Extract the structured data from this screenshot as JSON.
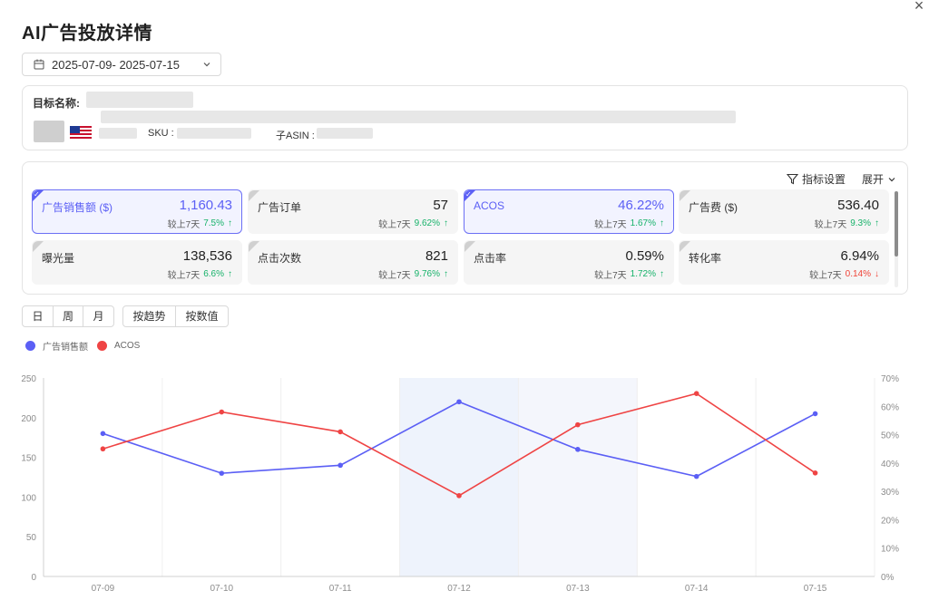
{
  "dialog": {
    "title": "AI广告投放详情",
    "close_symbol": "×"
  },
  "date_range": "2025-07-09- 2025-07-15",
  "target": {
    "name_label": "目标名称:",
    "sku_label": "SKU :",
    "asin_label": "子ASIN :"
  },
  "metrics_toolbar": {
    "settings_label": "指标设置",
    "expand_label": "展开"
  },
  "metrics": [
    {
      "label": "广告销售额 ($)",
      "value": "1,160.43",
      "compare_label": "较上7天",
      "change": "7.5%",
      "direction": "up",
      "arrow": "↑",
      "selected": true
    },
    {
      "label": "广告订单",
      "value": "57",
      "compare_label": "较上7天",
      "change": "9.62%",
      "direction": "up",
      "arrow": "↑",
      "selected": false
    },
    {
      "label": "ACOS",
      "value": "46.22%",
      "compare_label": "较上7天",
      "change": "1.67%",
      "direction": "up",
      "arrow": "↑",
      "selected": true
    },
    {
      "label": "广告费 ($)",
      "value": "536.40",
      "compare_label": "较上7天",
      "change": "9.3%",
      "direction": "up",
      "arrow": "↑",
      "selected": false
    },
    {
      "label": "曝光量",
      "value": "138,536",
      "compare_label": "较上7天",
      "change": "6.6%",
      "direction": "up",
      "arrow": "↑",
      "selected": false
    },
    {
      "label": "点击次数",
      "value": "821",
      "compare_label": "较上7天",
      "change": "9.76%",
      "direction": "up",
      "arrow": "↑",
      "selected": false
    },
    {
      "label": "点击率",
      "value": "0.59%",
      "compare_label": "较上7天",
      "change": "1.72%",
      "direction": "up",
      "arrow": "↑",
      "selected": false
    },
    {
      "label": "转化率",
      "value": "6.94%",
      "compare_label": "较上7天",
      "change": "0.14%",
      "direction": "down",
      "arrow": "↓",
      "selected": false
    }
  ],
  "granularity": {
    "options": [
      "日",
      "周",
      "月"
    ],
    "active": 0
  },
  "view_mode": {
    "options": [
      "按趋势",
      "按数值"
    ],
    "active": 0
  },
  "colors": {
    "accent": "#5c60f5",
    "series_sales": "#5b5ff5",
    "series_acos": "#ef4444",
    "up": "#17b26a",
    "down": "#f04438",
    "highlight": "#f2f5fc"
  },
  "chart_data": {
    "type": "line",
    "categories": [
      "07-09",
      "07-10",
      "07-11",
      "07-12",
      "07-13",
      "07-14",
      "07-15"
    ],
    "series": [
      {
        "name": "广告销售额",
        "axis": "left",
        "color": "#5b5ff5",
        "values": [
          180,
          130,
          140,
          220,
          160,
          126,
          205
        ]
      },
      {
        "name": "ACOS",
        "axis": "right",
        "color": "#ef4444",
        "values": [
          45,
          58,
          51,
          28.5,
          53.5,
          64.5,
          36.5
        ]
      }
    ],
    "y_left": {
      "min": 0,
      "max": 250,
      "ticks": [
        "0",
        "50",
        "100",
        "150",
        "200",
        "250"
      ]
    },
    "y_right": {
      "min": 0,
      "max": 70,
      "ticks": [
        "0%",
        "10%",
        "20%",
        "30%",
        "40%",
        "50%",
        "60%",
        "70%"
      ]
    },
    "highlighted_categories": [
      "07-12",
      "07-13"
    ],
    "grid": "vertical"
  }
}
